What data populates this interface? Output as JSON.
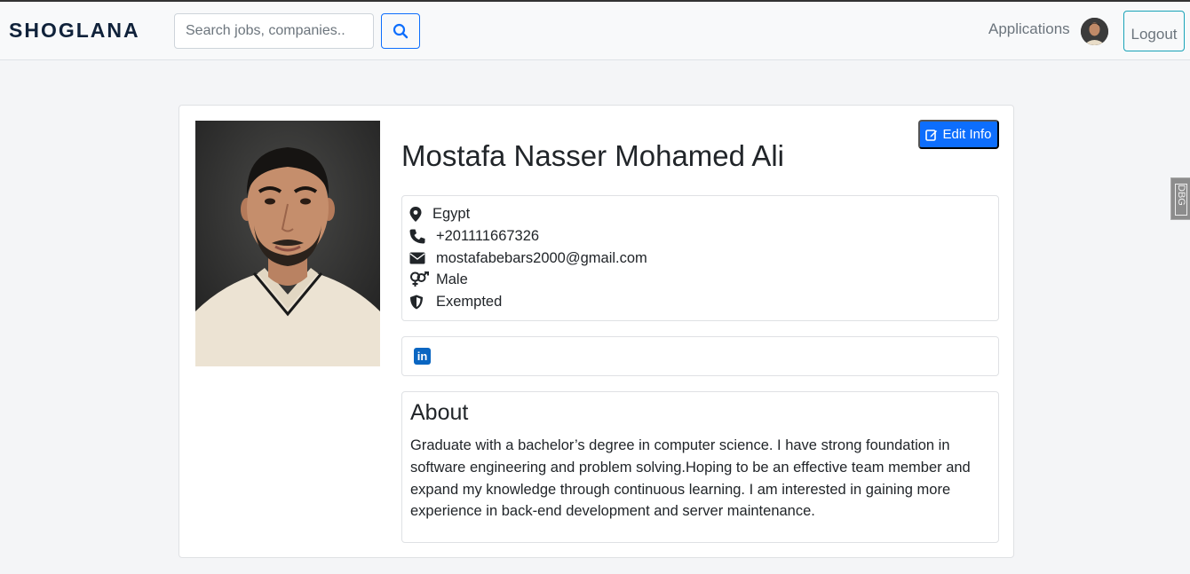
{
  "navbar": {
    "brand": "SHOGLANA",
    "search_placeholder": "Search jobs, companies..",
    "applications_label": "Applications",
    "logout_label": "Logout"
  },
  "profile": {
    "edit_label": "Edit Info",
    "name": "Mostafa Nasser Mohamed Ali",
    "details": [
      {
        "icon": "location-pin-icon",
        "value": "Egypt"
      },
      {
        "icon": "phone-icon",
        "value": "+201111667326"
      },
      {
        "icon": "envelope-icon",
        "value": "mostafabebars2000@gmail.com"
      },
      {
        "icon": "gender-icon",
        "value": "Male"
      },
      {
        "icon": "shield-icon",
        "value": "Exempted"
      }
    ],
    "about_title": "About",
    "about_text": "Graduate with a bachelor’s degree in computer science. I have strong foundation in software engineering and problem solving.Hoping to be an effective team member and expand my knowledge through continuous learning. I am interested in gaining more experience in back-end development and server maintenance."
  },
  "colors": {
    "primary": "#0d6efd",
    "brand": "#10223a",
    "linkedin": "#0a66c2"
  }
}
